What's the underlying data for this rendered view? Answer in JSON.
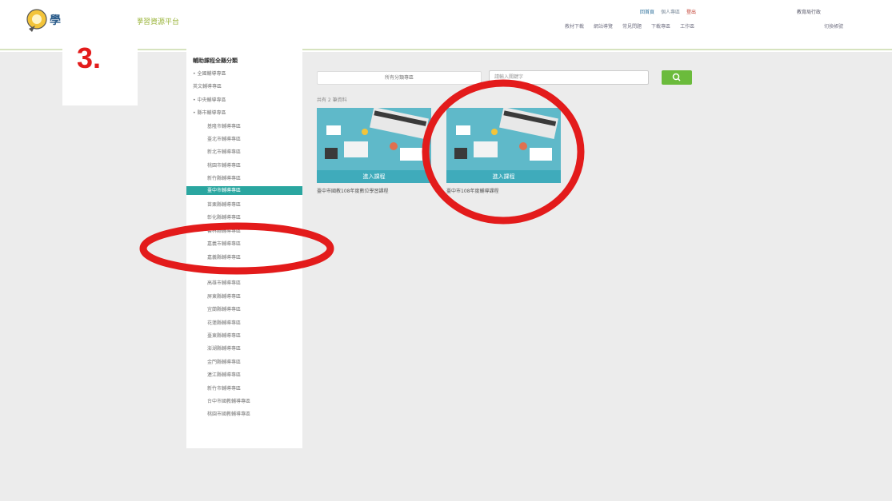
{
  "step_label": "3.",
  "header": {
    "logo_text": "學習資源平台",
    "top_links": [
      "回首頁",
      "個人專區",
      "登出"
    ],
    "account_text": "教育局行政",
    "account_sub": "切換帳號",
    "nav": [
      "教材下載",
      "網站導覽",
      "常見問題",
      "下載專區",
      "工作區"
    ]
  },
  "search": {
    "select_value": "所有分類專區",
    "placeholder": "請輸入關鍵字"
  },
  "result_count": "共有 2 筆資料",
  "sidebar": {
    "title": "輔助課程全縣分類",
    "items": [
      {
        "label": "• 全國輔導專區",
        "level": 1
      },
      {
        "label": "英文輔導專區",
        "level": 1
      },
      {
        "label": "• 中央輔導專區",
        "level": 1
      },
      {
        "label": "• 縣市輔導專區",
        "level": 1
      },
      {
        "label": "基隆市輔導專區",
        "level": 2
      },
      {
        "label": "臺北市輔導專區",
        "level": 2
      },
      {
        "label": "新北市輔導專區",
        "level": 2
      },
      {
        "label": "桃園市輔導專區",
        "level": 2
      },
      {
        "label": "新竹縣輔導專區",
        "level": 2
      },
      {
        "label": "臺中市輔導專區",
        "level": 2,
        "active": true
      },
      {
        "label": "苗栗縣輔導專區",
        "level": 2
      },
      {
        "label": "彰化縣輔導專區",
        "level": 2
      },
      {
        "label": "雲林縣輔導專區",
        "level": 2
      },
      {
        "label": "嘉義市輔導專區",
        "level": 2
      },
      {
        "label": "嘉義縣輔導專區",
        "level": 2
      },
      {
        "label": "臺南市輔導專區",
        "level": 2
      },
      {
        "label": "高雄市輔導專區",
        "level": 2
      },
      {
        "label": "屏東縣輔導專區",
        "level": 2
      },
      {
        "label": "宜蘭縣輔導專區",
        "level": 2
      },
      {
        "label": "花蓮縣輔導專區",
        "level": 2
      },
      {
        "label": "臺東縣輔導專區",
        "level": 2
      },
      {
        "label": "澎湖縣輔導專區",
        "level": 2
      },
      {
        "label": "金門縣輔導專區",
        "level": 2
      },
      {
        "label": "連江縣輔導專區",
        "level": 2
      },
      {
        "label": "新竹市輔導專區",
        "level": 2
      },
      {
        "label": "台中市國教輔導專區",
        "level": 2
      },
      {
        "label": "桃園市國教輔導專區",
        "level": 2
      }
    ]
  },
  "cards": [
    {
      "label": "進入課程",
      "caption": "臺中市國教108年度數位學習課程"
    },
    {
      "label": "進入課程",
      "caption": "臺中市108年度輔導課程"
    }
  ],
  "colors": {
    "accent_teal": "#2aa6a0",
    "search_green": "#6bbb3c",
    "annotation_red": "#e31b1b"
  }
}
